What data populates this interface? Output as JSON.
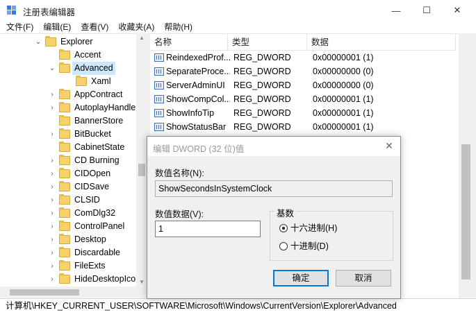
{
  "window": {
    "title": "注册表编辑器",
    "minimize": "—",
    "maximize": "☐",
    "close": "✕"
  },
  "menu": {
    "file": "文件(F)",
    "edit": "编辑(E)",
    "view": "查看(V)",
    "favorites": "收藏夹(A)",
    "help": "帮助(H)"
  },
  "tree": {
    "items": [
      {
        "label": "Explorer",
        "expander": "⌄",
        "level": 0
      },
      {
        "label": "Accent",
        "expander": "",
        "level": 1
      },
      {
        "label": "Advanced",
        "expander": "⌄",
        "level": 1,
        "selected": true
      },
      {
        "label": "Xaml",
        "expander": "",
        "level": 2
      },
      {
        "label": "AppContract",
        "expander": "›",
        "level": 1
      },
      {
        "label": "AutoplayHandler",
        "expander": "›",
        "level": 1
      },
      {
        "label": "BannerStore",
        "expander": "",
        "level": 1
      },
      {
        "label": "BitBucket",
        "expander": "›",
        "level": 1
      },
      {
        "label": "CabinetState",
        "expander": "",
        "level": 1
      },
      {
        "label": "CD Burning",
        "expander": "›",
        "level": 1
      },
      {
        "label": "CIDOpen",
        "expander": "›",
        "level": 1
      },
      {
        "label": "CIDSave",
        "expander": "›",
        "level": 1
      },
      {
        "label": "CLSID",
        "expander": "›",
        "level": 1
      },
      {
        "label": "ComDlg32",
        "expander": "›",
        "level": 1
      },
      {
        "label": "ControlPanel",
        "expander": "›",
        "level": 1
      },
      {
        "label": "Desktop",
        "expander": "›",
        "level": 1
      },
      {
        "label": "Discardable",
        "expander": "›",
        "level": 1
      },
      {
        "label": "FileExts",
        "expander": "›",
        "level": 1
      },
      {
        "label": "HideDesktopIcons",
        "expander": "›",
        "level": 1
      }
    ]
  },
  "list": {
    "headers": {
      "name": "名称",
      "type": "类型",
      "data": "数据"
    },
    "rows": [
      {
        "name": "ReindexedProf...",
        "type": "REG_DWORD",
        "data": "0x00000001 (1)"
      },
      {
        "name": "SeparateProce...",
        "type": "REG_DWORD",
        "data": "0x00000000 (0)"
      },
      {
        "name": "ServerAdminUI",
        "type": "REG_DWORD",
        "data": "0x00000000 (0)"
      },
      {
        "name": "ShowCompCol...",
        "type": "REG_DWORD",
        "data": "0x00000001 (1)"
      },
      {
        "name": "ShowInfoTip",
        "type": "REG_DWORD",
        "data": "0x00000001 (1)"
      },
      {
        "name": "ShowStatusBar",
        "type": "REG_DWORD",
        "data": "0x00000001 (1)"
      }
    ],
    "partial_value": "0"
  },
  "statusbar": {
    "path": "计算机\\HKEY_CURRENT_USER\\SOFTWARE\\Microsoft\\Windows\\CurrentVersion\\Explorer\\Advanced"
  },
  "dialog": {
    "title": "编辑 DWORD (32 位)值",
    "close": "✕",
    "name_label": "数值名称(N):",
    "name_value": "ShowSecondsInSystemClock",
    "data_label": "数值数据(V):",
    "data_value": "1",
    "base_label": "基数",
    "hex_label": "十六进制(H)",
    "dec_label": "十进制(D)",
    "selected_base": "hex",
    "ok": "确定",
    "cancel": "取消"
  }
}
